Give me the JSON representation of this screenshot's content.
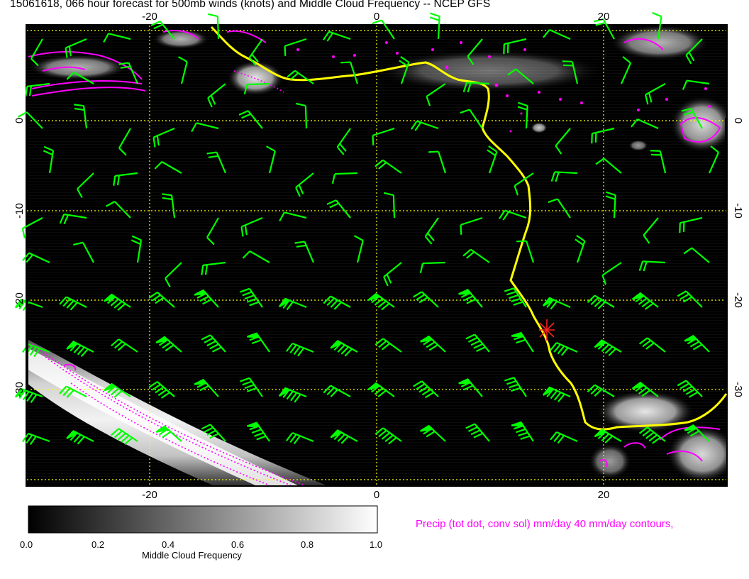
{
  "title": "15061618, 066 hour forecast for 500mb winds (knots) and Middle Cloud Frequency -- NCEP GFS",
  "map": {
    "lon_ticks": [
      "-20",
      "0",
      "20"
    ],
    "lat_ticks": [
      "0",
      "-10",
      "-20",
      "-30"
    ],
    "gridline_color": "#ffff00",
    "wind_barb_color": "#00ff00",
    "coastline_color": "#ffff00",
    "precip_contour_color": "#ff00ff",
    "station_marker": "red-star"
  },
  "colorbar": {
    "ticks": [
      "0.0",
      "0.2",
      "0.4",
      "0.6",
      "0.8",
      "1.0"
    ],
    "title": "Middle Cloud Frequency"
  },
  "precip_legend": "Precip (tot dot, conv sol) mm/day 40 mm/day contours,"
}
